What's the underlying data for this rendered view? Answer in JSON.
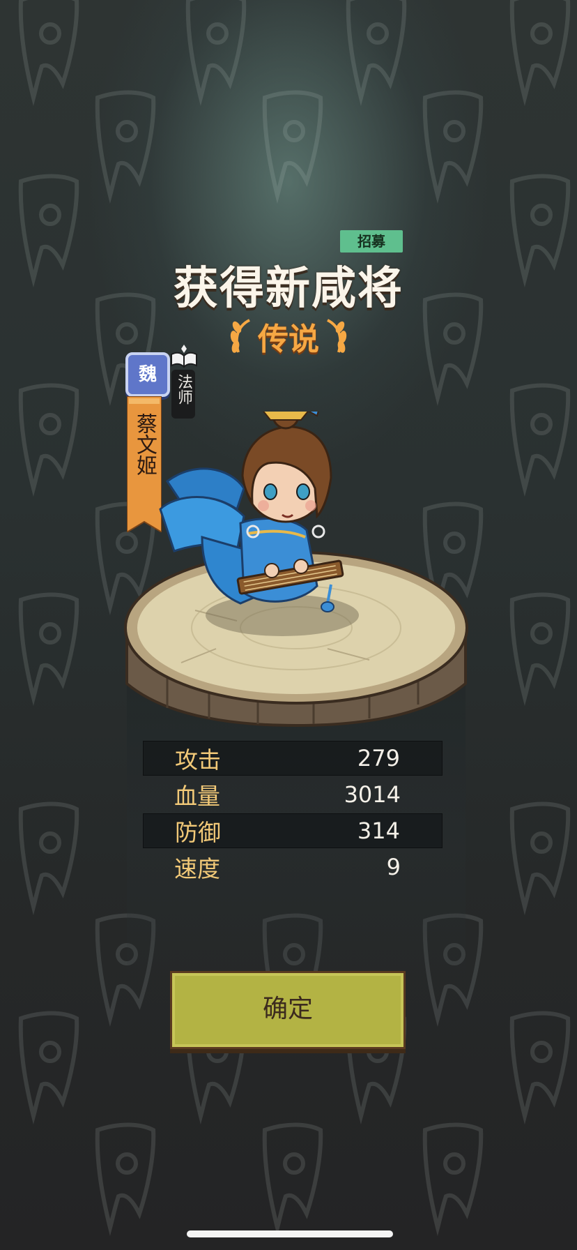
{
  "recruit_tag": "招募",
  "title": "获得新咸将",
  "rarity": "传说",
  "hero": {
    "faction": "魏",
    "name": "蔡文姬",
    "class_label": "法师",
    "class_icon": "book-icon"
  },
  "stats": [
    {
      "label": "攻击",
      "value": "279"
    },
    {
      "label": "血量",
      "value": "3014"
    },
    {
      "label": "防御",
      "value": "314"
    },
    {
      "label": "速度",
      "value": "9"
    }
  ],
  "confirm_label": "确定",
  "colors": {
    "recruit_tag": "#5fbf8e",
    "rarity": "#f6a844",
    "faction": "#5f76c9",
    "banner": "#e8963e",
    "confirm": "#b3b344"
  }
}
